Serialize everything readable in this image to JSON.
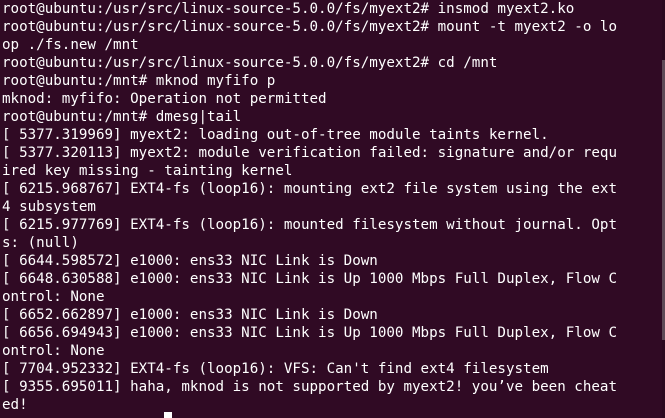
{
  "terminal": {
    "background": "#300a24",
    "foreground": "#ffffff",
    "lines": [
      "root@ubuntu:/usr/src/linux-source-5.0.0/fs/myext2# insmod myext2.ko",
      "root@ubuntu:/usr/src/linux-source-5.0.0/fs/myext2# mount -t myext2 -o lo",
      "op ./fs.new /mnt",
      "root@ubuntu:/usr/src/linux-source-5.0.0/fs/myext2# cd /mnt",
      "root@ubuntu:/mnt# mknod myfifo p",
      "mknod: myfifo: Operation not permitted",
      "root@ubuntu:/mnt# dmesg|tail",
      "[ 5377.319969] myext2: loading out-of-tree module taints kernel.",
      "[ 5377.320113] myext2: module verification failed: signature and/or requ",
      "ired key missing - tainting kernel",
      "[ 6215.968767] EXT4-fs (loop16): mounting ext2 file system using the ext",
      "4 subsystem",
      "[ 6215.977769] EXT4-fs (loop16): mounted filesystem without journal. Opt",
      "s: (null)",
      "[ 6644.598572] e1000: ens33 NIC Link is Down",
      "[ 6648.630588] e1000: ens33 NIC Link is Up 1000 Mbps Full Duplex, Flow C",
      "ontrol: None",
      "[ 6652.662897] e1000: ens33 NIC Link is Down",
      "[ 6656.694943] e1000: ens33 NIC Link is Up 1000 Mbps Full Duplex, Flow C",
      "ontrol: None",
      "[ 7704.952332] EXT4-fs (loop16): VFS: Can't find ext4 filesystem",
      "[ 9355.695011] haha, mknod is not supported by myext2! you’ve been cheat",
      "ed!"
    ]
  }
}
